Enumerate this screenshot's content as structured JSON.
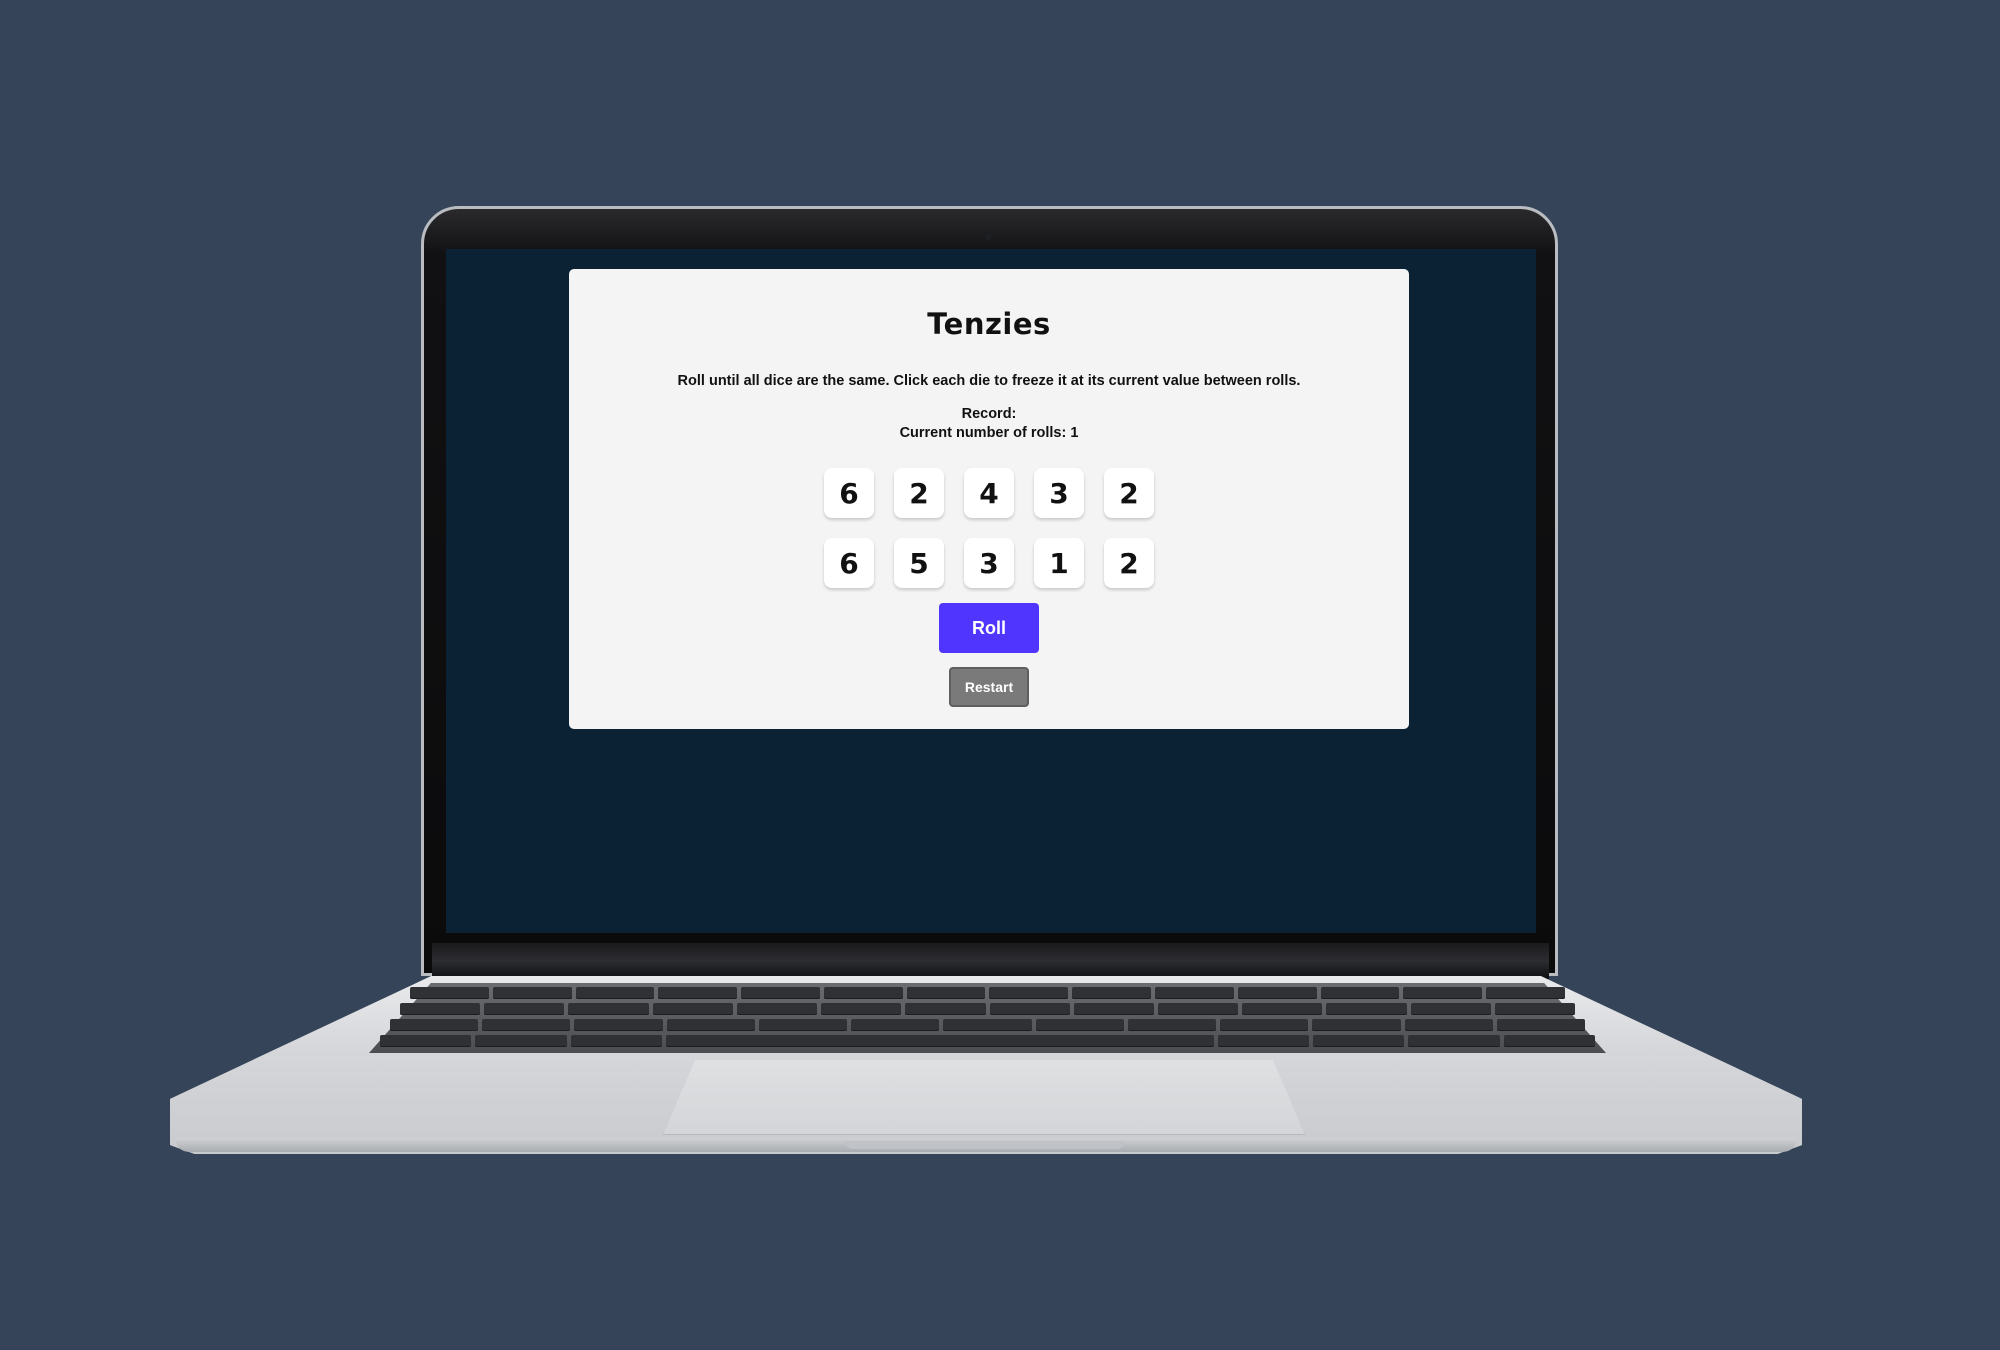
{
  "app": {
    "title": "Tenzies",
    "instructions": "Roll until all dice are the same. Click each die to freeze it at its current value between rolls.",
    "record_text": "Record:",
    "rolls_text": "Current number of rolls: 1"
  },
  "dice": [
    "6",
    "2",
    "4",
    "3",
    "2",
    "6",
    "5",
    "3",
    "1",
    "2"
  ],
  "buttons": {
    "roll_label": "Roll",
    "restart_label": "Restart"
  },
  "colors": {
    "page_background": "#354458",
    "screen_background": "#0b2234",
    "card_background": "#f4f4f4",
    "roll_button": "#5035ff",
    "restart_button": "#7a7a7a"
  }
}
